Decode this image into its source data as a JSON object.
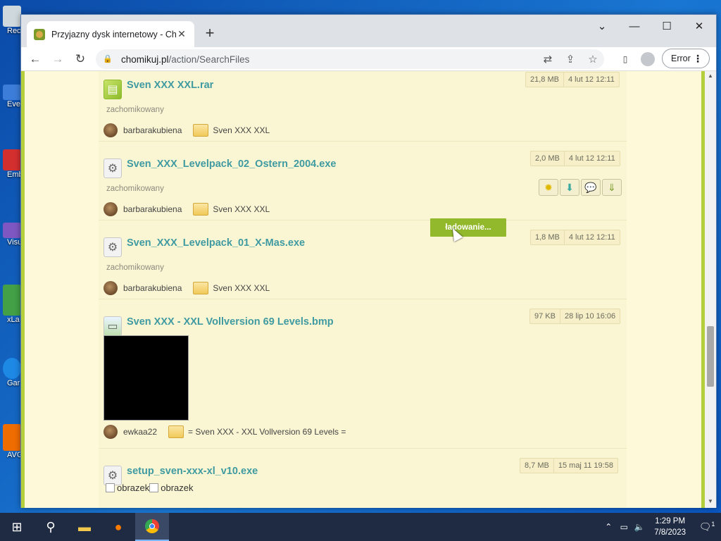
{
  "desktop": {
    "icons": [
      {
        "label": "Rec",
        "color": "#cfd8dc"
      },
      {
        "label": "Eve",
        "color": "#3c7dd9"
      },
      {
        "label": "Emb De",
        "color": "#d32f2f"
      },
      {
        "label": "Visu",
        "color": "#7e57c2"
      },
      {
        "label": "xLa",
        "color": "#43a047"
      },
      {
        "label": "Gar",
        "color": "#1e88e5"
      },
      {
        "label": "AVG",
        "color": "#ef6c00"
      }
    ]
  },
  "browser": {
    "tab_title": "Przyjazny dysk internetowy - Chomikuj.pl",
    "url_domain": "chomikuj.pl",
    "url_path": "/action/SearchFiles",
    "error_label": "Error"
  },
  "page": {
    "loading_label": "ładowanie...",
    "items": [
      {
        "name": "Sven XXX XXL.rar",
        "size": "21,8 MB",
        "date": "4 lut 12 12:11",
        "tag": "zachomikowany",
        "owner": "barbarakubiena",
        "folder": "Sven XXX XXL"
      },
      {
        "name": "Sven_XXX_Levelpack_02_Ostern_2004.exe",
        "size": "2,0 MB",
        "date": "4 lut 12 12:11",
        "tag": "zachomikowany",
        "owner": "barbarakubiena",
        "folder": "Sven XXX XXL"
      },
      {
        "name": "Sven_XXX_Levelpack_01_X-Mas.exe",
        "size": "1,8 MB",
        "date": "4 lut 12 12:11",
        "tag": "zachomikowany",
        "owner": "barbarakubiena",
        "folder": "Sven XXX XXL"
      },
      {
        "name": "Sven XXX - XXL Vollversion 69 Levels.bmp",
        "size": "97 KB",
        "date": "28 lip 10 16:06",
        "owner": "ewkaa22",
        "folder": "= Sven XXX - XXL Vollversion 69 Levels ="
      },
      {
        "name": "setup_sven-xxx-xl_v10.exe",
        "size": "8,7 MB",
        "date": "15 maj 11 19:58",
        "broken_img_1": "obrazek",
        "broken_img_2": "obrazek"
      }
    ]
  },
  "taskbar": {
    "time": "1:29 PM",
    "date": "7/8/2023",
    "notifications": "1"
  }
}
